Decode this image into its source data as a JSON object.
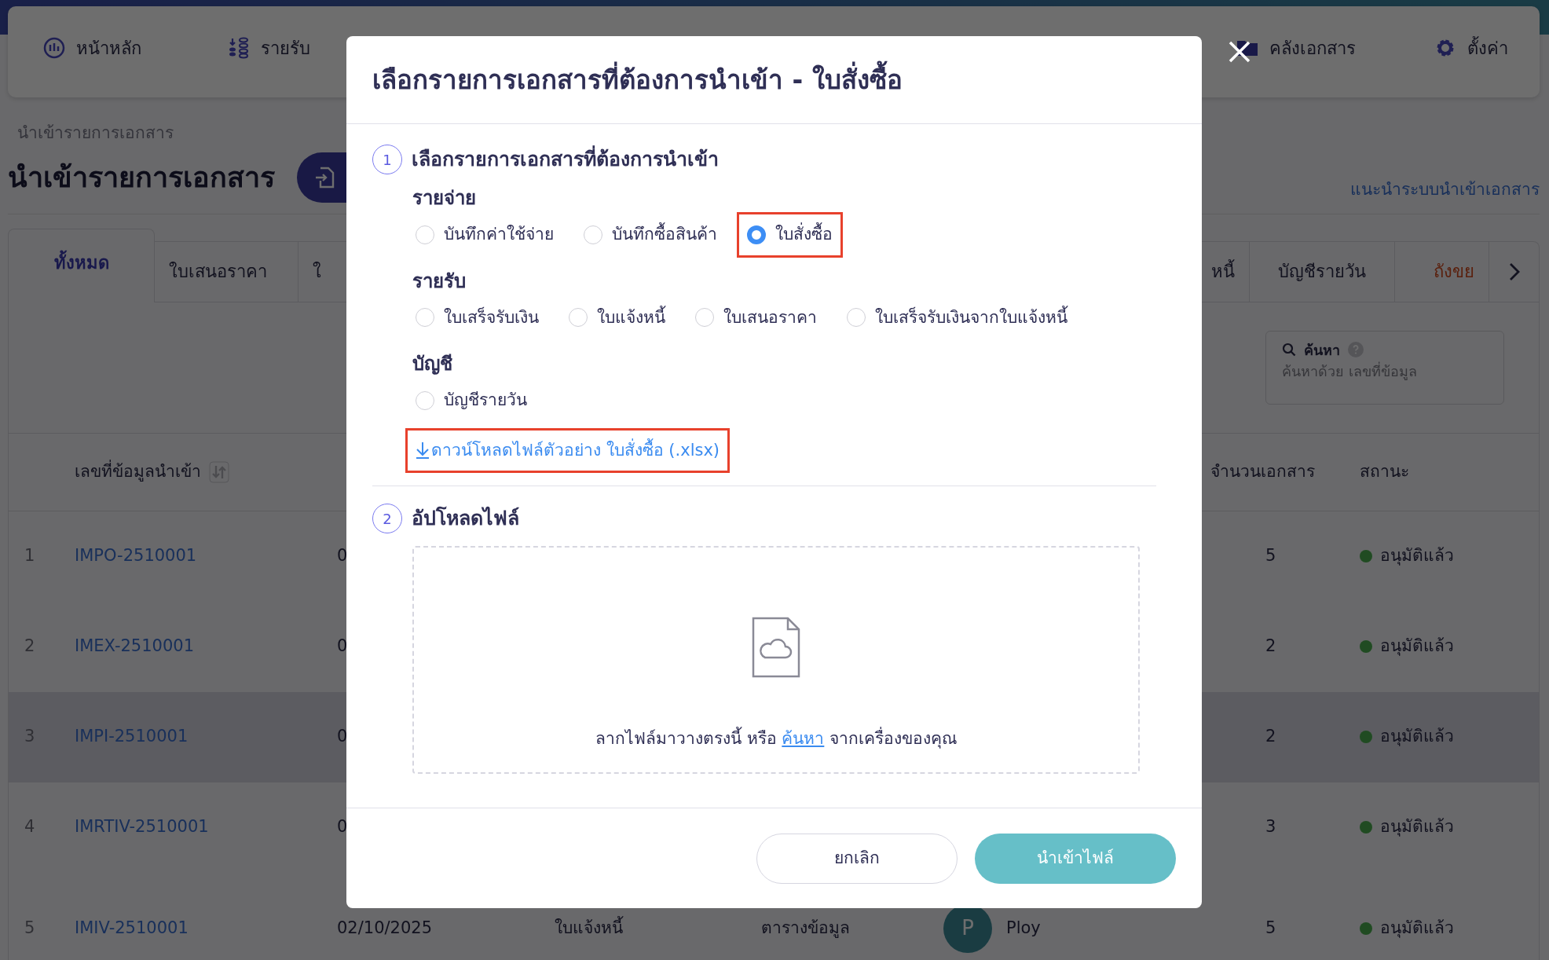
{
  "nav": {
    "left": [
      {
        "label": "หน้าหลัก",
        "kind": "home"
      },
      {
        "label": "รายรับ",
        "kind": "income"
      }
    ],
    "right": [
      {
        "label": "คลังเอกสาร",
        "kind": "library"
      },
      {
        "label": "ตั้งค่า",
        "kind": "settings"
      }
    ]
  },
  "breadcrumb": "นำเข้ารายการเอกสาร",
  "page_title": "นำเข้ารายการเอกสาร",
  "guide_link": "แนะนำระบบนำเข้าเอกสาร",
  "tabs": {
    "left": [
      {
        "label": "ทั้งหมด",
        "selected": true,
        "kind": "normal"
      },
      {
        "label": "ใบเสนอราคา",
        "selected": false,
        "kind": "normal"
      },
      {
        "label": "ใ",
        "selected": false,
        "kind": "normal"
      }
    ],
    "right": [
      {
        "label": "หนี้",
        "selected": false,
        "kind": "normal"
      },
      {
        "label": "บัญชีรายวัน",
        "selected": false,
        "kind": "normal"
      },
      {
        "label": "ถังขย",
        "selected": false,
        "kind": "trash"
      }
    ]
  },
  "search": {
    "label": "ค้นหา",
    "placeholder": "ค้นหาด้วย เลขที่ข้อมูล"
  },
  "table": {
    "columns": [
      {
        "label": "เลขที่ข้อมูลนำเข้า",
        "sortable": true
      },
      {
        "label": "จำนวนเอกสาร",
        "sortable": false
      },
      {
        "label": "สถานะ",
        "sortable": false
      }
    ],
    "rows": [
      {
        "no": "1",
        "id": "IMPO-2510001",
        "date": "0",
        "count": "5",
        "status": "อนุมัติแล้ว",
        "highlighted": false
      },
      {
        "no": "2",
        "id": "IMEX-2510001",
        "date": "0",
        "count": "2",
        "status": "อนุมัติแล้ว",
        "highlighted": false
      },
      {
        "no": "3",
        "id": "IMPI-2510001",
        "date": "0",
        "count": "2",
        "status": "อนุมัติแล้ว",
        "highlighted": true
      },
      {
        "no": "4",
        "id": "IMRTIV-2510001",
        "date": "0",
        "count": "3",
        "status": "อนุมัติแล้ว",
        "highlighted": false
      },
      {
        "no": "5",
        "id": "IMIV-2510001",
        "date": "02/10/2025",
        "type": "ใบแจ้งหนี้",
        "source": "ตารางข้อมูล",
        "avatar": "P",
        "user": "Ploy",
        "count": "5",
        "status": "อนุมัติแล้ว",
        "highlighted": false
      }
    ]
  },
  "modal": {
    "title": "เลือกรายการเอกสารที่ต้องการนำเข้า - ใบสั่งซื้อ",
    "steps": [
      {
        "number": "1",
        "title": "เลือกรายการเอกสารที่ต้องการนำเข้า"
      },
      {
        "number": "2",
        "title": "อัปโหลดไฟล์"
      }
    ],
    "groups": [
      {
        "label": "รายจ่าย",
        "options": [
          {
            "label": "บันทึกค่าใช้จ่าย",
            "selected": false,
            "highlighted": false
          },
          {
            "label": "บันทึกซื้อสินค้า",
            "selected": false,
            "highlighted": false
          },
          {
            "label": "ใบสั่งซื้อ",
            "selected": true,
            "highlighted": true
          }
        ]
      },
      {
        "label": "รายรับ",
        "options": [
          {
            "label": "ใบเสร็จรับเงิน",
            "selected": false,
            "highlighted": false
          },
          {
            "label": "ใบแจ้งหนี้",
            "selected": false,
            "highlighted": false
          },
          {
            "label": "ใบเสนอราคา",
            "selected": false,
            "highlighted": false
          },
          {
            "label": "ใบเสร็จรับเงินจากใบแจ้งหนี้",
            "selected": false,
            "highlighted": false
          }
        ]
      },
      {
        "label": "บัญชี",
        "options": [
          {
            "label": "บัญชีรายวัน",
            "selected": false,
            "highlighted": false
          }
        ]
      }
    ],
    "download": {
      "label": "ดาวน์โหลดไฟล์ตัวอย่าง ใบสั่งซื้อ (.xlsx)",
      "highlighted": true
    },
    "dropzone": {
      "before": "ลากไฟล์มาวางตรงนี้ หรือ",
      "link": "ค้นหา",
      "after": "จากเครื่องของคุณ"
    },
    "buttons": [
      {
        "label": "ยกเลิก",
        "kind": "secondary"
      },
      {
        "label": "นำเข้าไฟล์",
        "kind": "primary"
      }
    ]
  }
}
